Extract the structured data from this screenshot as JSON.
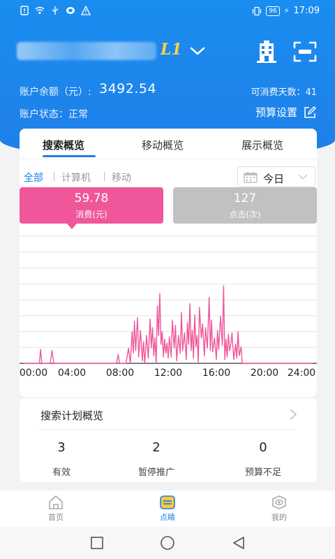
{
  "status_bar": {
    "time": "17:09",
    "battery": "96"
  },
  "account": {
    "level": "L1"
  },
  "balance": {
    "label": "账户余额（元）:",
    "value": "3492.54",
    "days": "可消费天数：41"
  },
  "status": {
    "label": "账户状态：正常",
    "budget_label": "预算设置"
  },
  "tabs": [
    {
      "label": "搜索概览",
      "active": true
    },
    {
      "label": "移动概览",
      "active": false
    },
    {
      "label": "展示概览",
      "active": false
    }
  ],
  "filters": [
    {
      "label": "全部",
      "active": true
    },
    {
      "label": "计算机",
      "active": false
    },
    {
      "label": "移动",
      "active": false
    }
  ],
  "date_select": {
    "value": "今日"
  },
  "metrics": {
    "cost": {
      "value": "59.78",
      "label": "消费(元)"
    },
    "clicks": {
      "value": "127",
      "label": "点击(次)"
    }
  },
  "chart_data": {
    "type": "line",
    "x_tick_labels": [
      "00:00",
      "04:00",
      "08:00",
      "12:00",
      "16:00",
      "20:00",
      "24:00"
    ],
    "x_unit": "hour",
    "xlim": [
      0,
      24
    ],
    "ylim": [
      0,
      10
    ],
    "grid": true,
    "series": [
      {
        "color": "#f0579a",
        "points": [
          [
            0.0,
            0
          ],
          [
            1.0,
            0
          ],
          [
            1.3,
            0
          ],
          [
            1.4,
            1.1
          ],
          [
            1.5,
            0
          ],
          [
            2.2,
            0
          ],
          [
            2.35,
            1.0
          ],
          [
            2.5,
            0
          ],
          [
            3.0,
            0
          ],
          [
            4.0,
            0
          ],
          [
            5.0,
            0
          ],
          [
            6.0,
            0
          ],
          [
            7.0,
            0
          ],
          [
            7.7,
            0
          ],
          [
            7.85,
            0.7
          ],
          [
            7.95,
            0
          ],
          [
            8.5,
            0
          ],
          [
            8.7,
            1.2
          ],
          [
            8.85,
            0
          ],
          [
            9.0,
            2.5
          ],
          [
            9.1,
            0.8
          ],
          [
            9.2,
            3.3
          ],
          [
            9.3,
            1.0
          ],
          [
            9.45,
            3.6
          ],
          [
            9.55,
            0.5
          ],
          [
            9.7,
            2.6
          ],
          [
            9.85,
            0.2
          ],
          [
            9.95,
            1.7
          ],
          [
            10.05,
            0
          ],
          [
            10.2,
            2.2
          ],
          [
            10.35,
            0.4
          ],
          [
            10.5,
            3.5
          ],
          [
            10.6,
            1.2
          ],
          [
            10.7,
            2.8
          ],
          [
            10.8,
            0.6
          ],
          [
            10.9,
            2.0
          ],
          [
            11.0,
            0
          ],
          [
            11.1,
            4.5
          ],
          [
            11.2,
            2.2
          ],
          [
            11.3,
            5.5
          ],
          [
            11.4,
            1.5
          ],
          [
            11.5,
            2.5
          ],
          [
            11.6,
            0.5
          ],
          [
            11.7,
            1.9
          ],
          [
            11.8,
            0.8
          ],
          [
            11.9,
            1.6
          ],
          [
            12.0,
            0.4
          ],
          [
            12.1,
            2.1
          ],
          [
            12.25,
            0.5
          ],
          [
            12.35,
            3.4
          ],
          [
            12.5,
            1.2
          ],
          [
            12.6,
            3.0
          ],
          [
            12.7,
            0.2
          ],
          [
            12.85,
            2.2
          ],
          [
            13.0,
            0.8
          ],
          [
            13.1,
            4.0
          ],
          [
            13.2,
            1.0
          ],
          [
            13.35,
            2.4
          ],
          [
            13.5,
            0.3
          ],
          [
            13.6,
            3.2
          ],
          [
            13.7,
            1.5
          ],
          [
            13.8,
            4.7
          ],
          [
            13.9,
            1.0
          ],
          [
            14.0,
            2.6
          ],
          [
            14.1,
            0.4
          ],
          [
            14.2,
            3.8
          ],
          [
            14.3,
            1.3
          ],
          [
            14.4,
            2.2
          ],
          [
            14.5,
            0.1
          ],
          [
            14.6,
            4.4
          ],
          [
            14.75,
            2.0
          ],
          [
            14.85,
            3.1
          ],
          [
            15.0,
            0.6
          ],
          [
            15.1,
            2.8
          ],
          [
            15.25,
            1.2
          ],
          [
            15.4,
            5.2
          ],
          [
            15.5,
            1.0
          ],
          [
            15.6,
            3.4
          ],
          [
            15.7,
            0.9
          ],
          [
            15.85,
            2.0
          ],
          [
            16.0,
            0.3
          ],
          [
            16.1,
            2.6
          ],
          [
            16.2,
            1.1
          ],
          [
            16.35,
            3.7
          ],
          [
            16.5,
            1.4
          ],
          [
            16.6,
            6.1
          ],
          [
            16.7,
            0.3
          ],
          [
            16.8,
            1.9
          ],
          [
            16.9,
            0.5
          ],
          [
            17.0,
            2.3
          ],
          [
            17.1,
            1.0
          ],
          [
            17.2,
            1.5
          ],
          [
            17.3,
            2.4
          ],
          [
            17.45,
            0.3
          ],
          [
            17.6,
            1.5
          ],
          [
            17.7,
            0.4
          ],
          [
            17.8,
            2.5
          ],
          [
            17.9,
            0.6
          ],
          [
            18.05,
            1.3
          ],
          [
            18.15,
            0
          ],
          [
            24.0,
            0
          ]
        ]
      }
    ]
  },
  "plan_overview": {
    "title": "搜索计划概览",
    "stats": [
      {
        "num": "3",
        "label": "有效"
      },
      {
        "num": "2",
        "label": "暂停推广"
      },
      {
        "num": "0",
        "label": "预算不足"
      }
    ]
  },
  "bottom_nav": [
    {
      "label": "首页",
      "icon": "home-icon",
      "active": false
    },
    {
      "label": "点睛",
      "icon": "dianjing-icon",
      "active": true
    },
    {
      "label": "我的",
      "icon": "profile-icon",
      "active": false
    }
  ],
  "colors": {
    "primary": "#1f7fe8",
    "accent_pink": "#f0579a",
    "level_gold": "#ffd34d",
    "metric_gray": "#c1c1c1"
  }
}
